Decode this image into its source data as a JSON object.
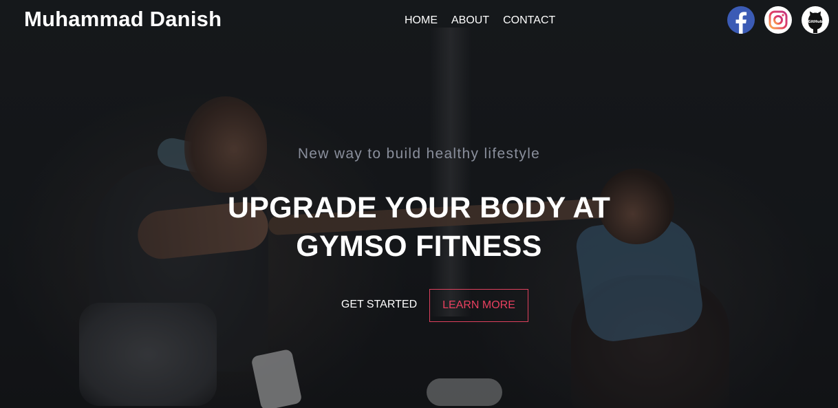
{
  "header": {
    "brand": "Muhammad Danish",
    "nav": [
      "HOME",
      "ABOUT",
      "CONTACT"
    ],
    "socials": [
      {
        "name": "facebook",
        "icon": "facebook-icon",
        "color": "#3b5bb5"
      },
      {
        "name": "instagram",
        "icon": "instagram-icon",
        "color": "#e4405f"
      },
      {
        "name": "github",
        "icon": "github-icon",
        "color": "#000000",
        "label": "GitHub"
      }
    ]
  },
  "hero": {
    "subtitle": "New way to build healthy lifestyle",
    "title_line1": "UPGRADE YOUR BODY AT",
    "title_line2": "GYMSO FITNESS",
    "primary_button": "GET STARTED",
    "secondary_button": "LEARN MORE",
    "accent_color": "#e8405f"
  }
}
